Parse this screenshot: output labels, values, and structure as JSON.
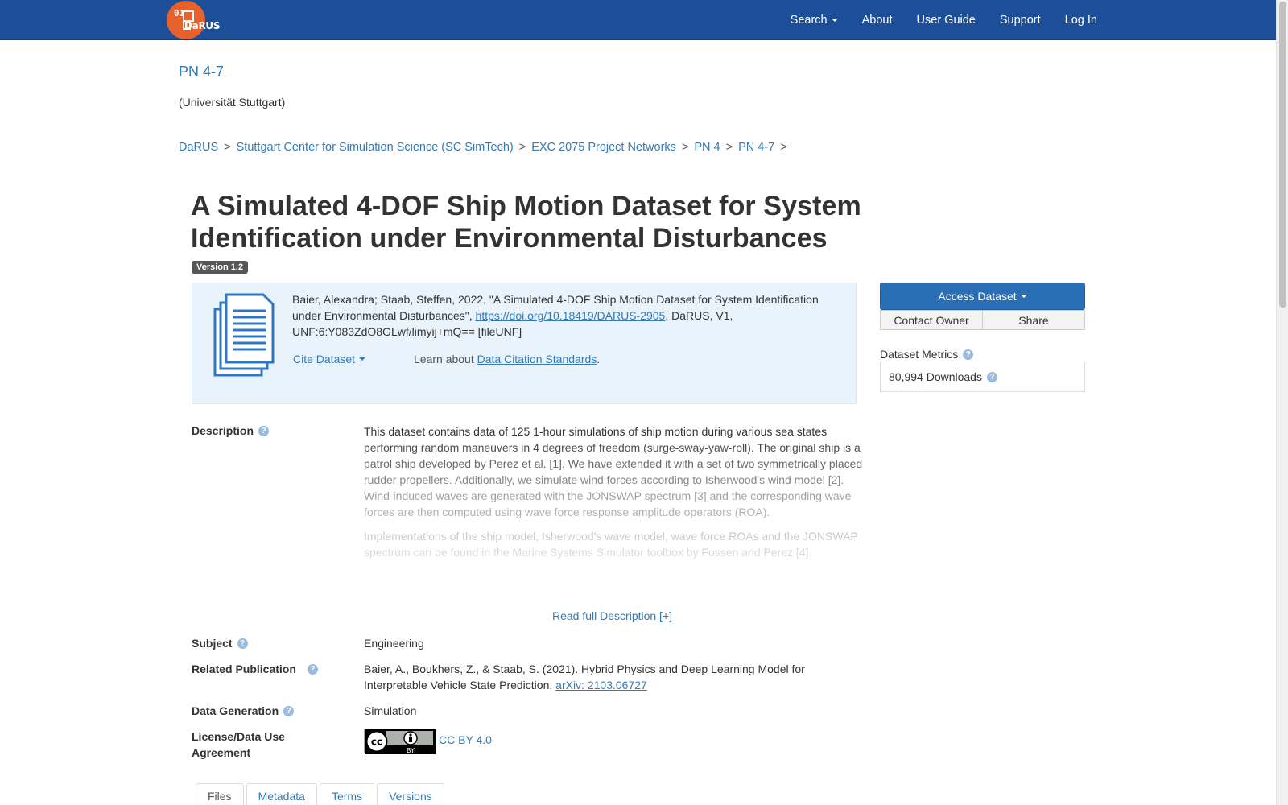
{
  "navbar": {
    "logo_text": "DaRUS",
    "logo_small": "01",
    "links": [
      "Search",
      "About",
      "User Guide",
      "Support",
      "Log In"
    ]
  },
  "dataverse": {
    "title": "PN 4-7",
    "affiliation": "(Universität Stuttgart)"
  },
  "breadcrumb": [
    "DaRUS",
    "Stuttgart Center for Simulation Science (SC SimTech)",
    "EXC 2075 Project Networks",
    "PN 4",
    "PN 4-7"
  ],
  "dataset": {
    "title": "A Simulated 4-DOF Ship Motion Dataset for System Identification under Environmental Disturbances",
    "version": "Version 1.2",
    "citation_pre": "Baier, Alexandra; Staab, Steffen, 2022, \"A Simulated 4-DOF Ship Motion Dataset for System Identification under Environmental Disturbances\", ",
    "citation_doi": "https://doi.org/10.18419/DARUS-2905",
    "citation_post": ", DaRUS, V1, UNF:6:Y083ZdO8GLwf/limyij+mQ== [fileUNF]",
    "cite_button": "Cite Dataset",
    "learn_prefix": "Learn about ",
    "learn_link": "Data Citation Standards",
    "learn_suffix": "."
  },
  "sidebar": {
    "access_button": "Access Dataset",
    "contact_button": "Contact Owner",
    "share_button": "Share",
    "metrics_label": "Dataset Metrics",
    "downloads": "80,994 Downloads"
  },
  "fields": {
    "description_label": "Description",
    "description_p1": "This dataset contains data of 125 1-hour simulations of ship motion during various sea states performing random maneuvers in 4 degrees of freedom (surge-sway-yaw-roll). The original ship is a patrol ship developed by Perez et al. [1]. We have extended it with a set of two symmetrically placed rudder propellers. Additionally, we simulate wind forces according to Isherwood's wind model [2]. Wind-induced waves are generated with the JONSWAP spectrum [3] and the corresponding wave forces are then computed using wave force response amplitude operators (ROA).",
    "description_p2": "Implementations of the ship model, Isherwood's wave model, wave force ROAs and the JONSWAP spectrum can be found in the Marine Systems Simulator toolbox by Fossen and Perez [4].",
    "read_full": "Read full Description [+]",
    "subject_label": "Subject",
    "subject_value": "Engineering",
    "related_label": "Related Publication",
    "related_value": "Baier, A., Boukhers, Z., & Staab, S. (2021). Hybrid Physics and Deep Learning Model for Interpretable Vehicle State Prediction. ",
    "related_link": "arXiv: 2103.06727",
    "datagen_label": "Data Generation",
    "datagen_value": "Simulation",
    "license_label": "License/Data Use Agreement",
    "license_value": "CC BY 4.0",
    "cc_badge_cc": "cc",
    "cc_badge_by": "BY"
  },
  "tabs": [
    "Files",
    "Metadata",
    "Terms",
    "Versions"
  ],
  "colors": {
    "navbar": "#1d4f99",
    "logo": "#e8612c",
    "link": "#337ab7",
    "primary_button": "#2a6fb5",
    "citation_box": "#e8f3fb"
  }
}
